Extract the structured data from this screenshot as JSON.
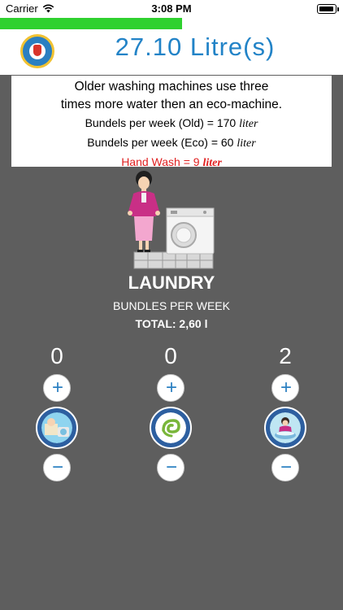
{
  "status_bar": {
    "carrier": "Carrier",
    "time": "3:08 PM"
  },
  "progress": {
    "value_percent": 53
  },
  "header": {
    "title": "27.10 Litre(s)"
  },
  "info": {
    "line1": "Older washing machines use three",
    "line2": "times more water then an eco-machine.",
    "old_text": "Bundels per week (Old) = 170",
    "eco_text": "Bundels per week (Eco) = 60",
    "unit": "liter",
    "hand_text": "Hand Wash = 9",
    "hand_unit": "liter"
  },
  "section": {
    "title": "LAUNDRY",
    "subtitle": "BUNDLES PER WEEK",
    "total": "TOTAL: 2,60 l"
  },
  "counters": [
    {
      "value": "0",
      "plus": "+",
      "minus": "−",
      "icon": "old-washing-machine-icon"
    },
    {
      "value": "0",
      "plus": "+",
      "minus": "−",
      "icon": "eco-machine-icon"
    },
    {
      "value": "2",
      "plus": "+",
      "minus": "−",
      "icon": "hand-wash-icon"
    }
  ],
  "colors": {
    "background": "#5e5e5e",
    "accent": "#2283c7",
    "progress": "#2fd12f",
    "hand_wash": "#e02020"
  }
}
